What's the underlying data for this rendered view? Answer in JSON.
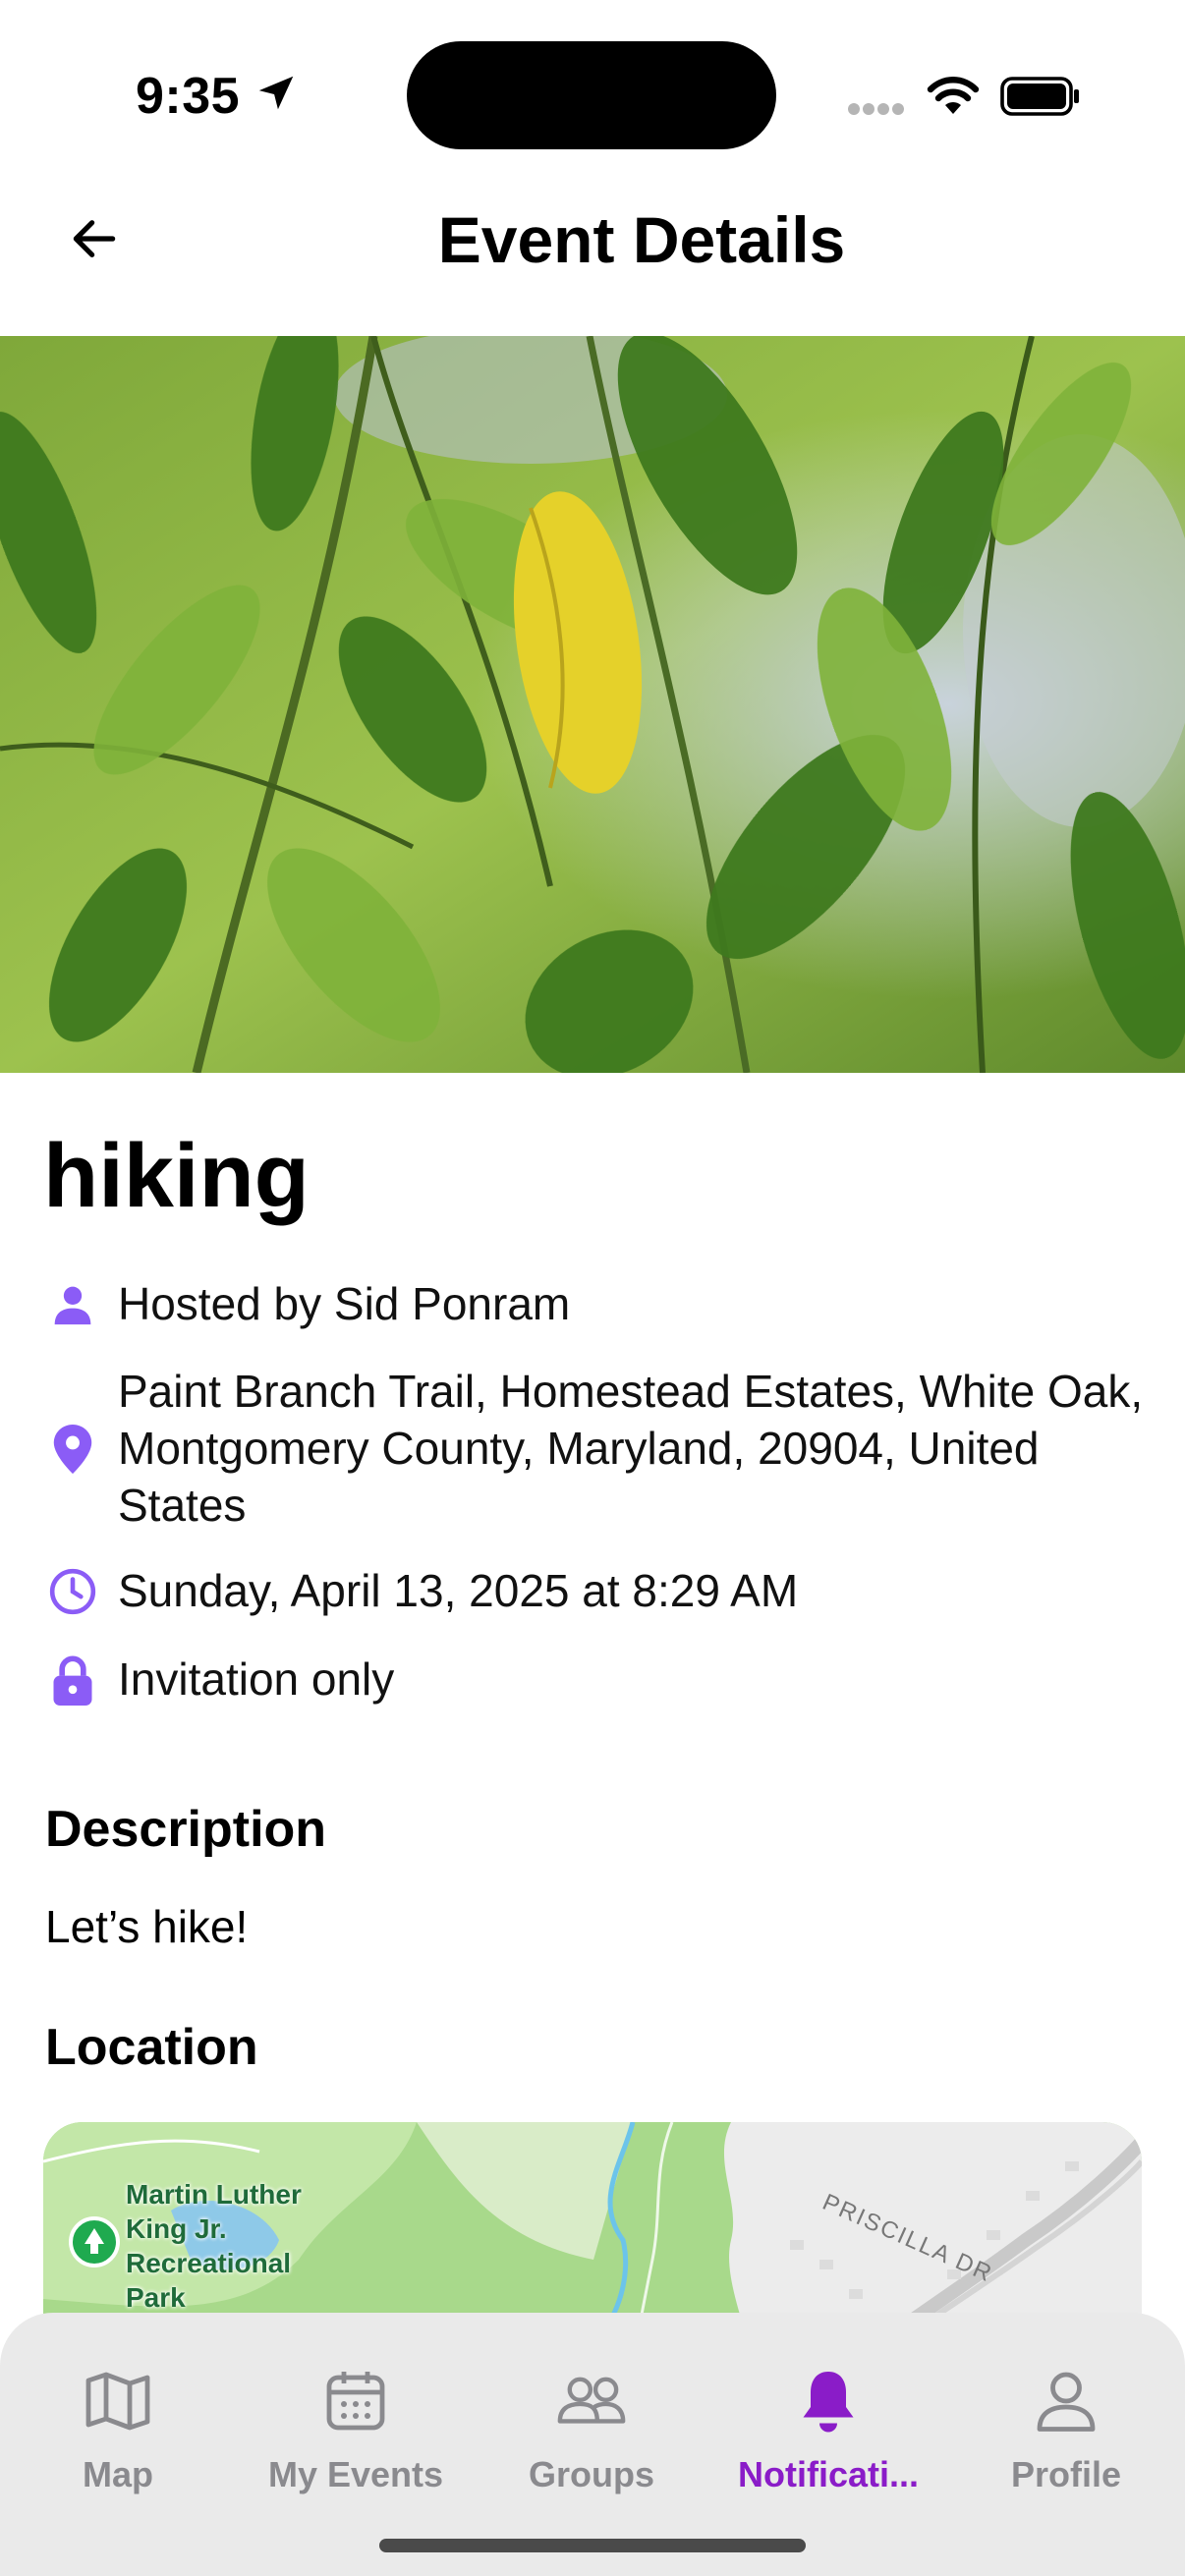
{
  "status_bar": {
    "time": "9:35"
  },
  "header": {
    "title": "Event Details"
  },
  "event": {
    "name": "hiking",
    "host": "Hosted by Sid Ponram",
    "address_lines": [
      "Paint Branch Trail, Homestead Estates, White Oak,",
      "Montgomery County, Maryland, 20904, United",
      "States"
    ],
    "datetime": "Sunday, April 13, 2025 at 8:29 AM",
    "visibility": "Invitation only"
  },
  "sections": {
    "description_heading": "Description",
    "description_text": "Let’s hike!",
    "location_heading": "Location"
  },
  "map": {
    "park_label_lines": [
      "Martin Luther",
      "King Jr.",
      "Recreational",
      "Park"
    ],
    "street_label": "PRISCILLA DR"
  },
  "tab_bar": {
    "tabs": [
      {
        "label": "Map",
        "icon": "map-icon",
        "active": false
      },
      {
        "label": "My Events",
        "icon": "calendar-icon",
        "active": false
      },
      {
        "label": "Groups",
        "icon": "groups-icon",
        "active": false
      },
      {
        "label": "Notificati...",
        "icon": "bell-icon",
        "active": true
      },
      {
        "label": "Profile",
        "icon": "profile-icon",
        "active": false
      }
    ]
  },
  "colors": {
    "accent": "#8b5cf6",
    "active_tab": "#8a1cc8",
    "tab_inactive": "#8a8a8e"
  }
}
